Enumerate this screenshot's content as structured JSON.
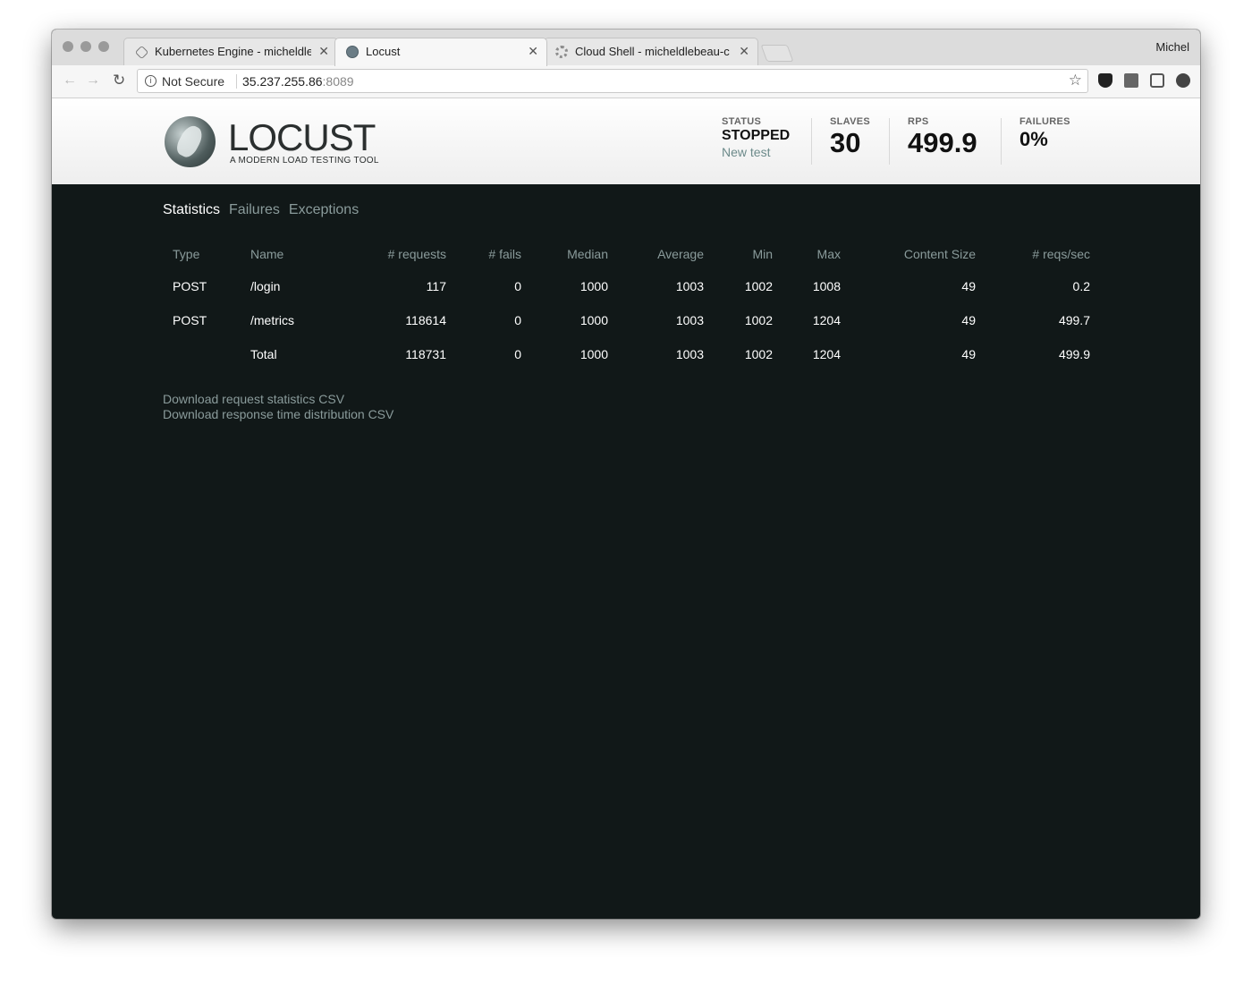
{
  "browser": {
    "profile": "Michel",
    "tabs": [
      {
        "title": "Kubernetes Engine - micheldle",
        "icon": "kubernetes-icon"
      },
      {
        "title": "Locust",
        "icon": "globe-icon"
      },
      {
        "title": "Cloud Shell - micheldlebeau-c",
        "icon": "gear-icon"
      }
    ],
    "security_label": "Not Secure",
    "url_host": "35.237.255.86",
    "url_port": ":8089"
  },
  "locust": {
    "logo_title": "LOCUST",
    "logo_subtitle": "A MODERN LOAD TESTING TOOL",
    "status": {
      "label": "STATUS",
      "value": "STOPPED",
      "action": "New test"
    },
    "slaves": {
      "label": "SLAVES",
      "value": "30"
    },
    "rps": {
      "label": "RPS",
      "value": "499.9"
    },
    "failures": {
      "label": "FAILURES",
      "value": "0%"
    }
  },
  "nav": {
    "statistics": "Statistics",
    "failures": "Failures",
    "exceptions": "Exceptions"
  },
  "table": {
    "headers": [
      "Type",
      "Name",
      "# requests",
      "# fails",
      "Median",
      "Average",
      "Min",
      "Max",
      "Content Size",
      "# reqs/sec"
    ],
    "rows": [
      [
        "POST",
        "/login",
        "117",
        "0",
        "1000",
        "1003",
        "1002",
        "1008",
        "49",
        "0.2"
      ],
      [
        "POST",
        "/metrics",
        "118614",
        "0",
        "1000",
        "1003",
        "1002",
        "1204",
        "49",
        "499.7"
      ],
      [
        "",
        "Total",
        "118731",
        "0",
        "1000",
        "1003",
        "1002",
        "1204",
        "49",
        "499.9"
      ]
    ]
  },
  "downloads": {
    "request_stats": "Download request statistics CSV",
    "response_dist": "Download response time distribution CSV"
  }
}
